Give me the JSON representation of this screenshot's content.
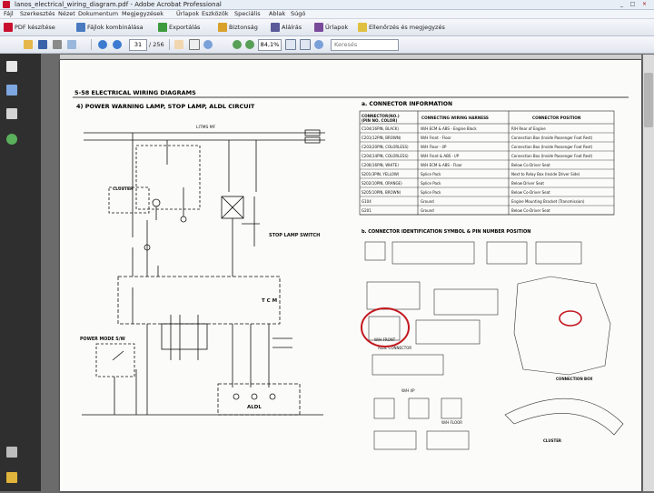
{
  "window": {
    "title": "lanos_electrical_wiring_diagram.pdf - Adobe Acrobat Professional",
    "controls": [
      "_",
      "□",
      "×"
    ]
  },
  "menu": [
    "Fájl",
    "Szerkesztés",
    "Nézet",
    "Dokumentum",
    "Megjegyzések",
    "Űrlapok",
    "Eszközök",
    "Speciális",
    "Ablak",
    "Súgó"
  ],
  "toolbar1": {
    "create_pdf": "PDF készítése",
    "combine": "Fájlok kombinálása",
    "export": "Exportálás",
    "security": "Biztonság",
    "sign": "Aláírás",
    "forms": "Űrlapok",
    "review": "Ellenőrzés és megjegyzés"
  },
  "toolbar2": {
    "page_current": "31",
    "page_total": "/ 256",
    "zoom": "84,1%",
    "search_placeholder": "Keresés"
  },
  "doc": {
    "header": "5-58  ELECTRICAL WIRING DIAGRAMS",
    "left_title": "4)  POWER WARNING LAMP, STOP LAMP, ALDL  CIRCUIT",
    "right_title": "a.  CONNECTOR INFORMATION",
    "conn_symbol_title": "b.  CONNECTOR IDENTIFICATION SYMBOL & PIN NUMBER POSITION",
    "table_headers": [
      "CONNECTOR(NO.)\n(PIN NO. COLOR)",
      "CONNECTING  WIRING HARNESS",
      "CONNECTOR POSITION"
    ],
    "table_rows": [
      [
        "C104(16PIN, BLACK)",
        "W/H ECM & ABS - Engine Block",
        "R/H Rear of Engine"
      ],
      [
        "C201(12PIN, BROWN)",
        "W/H Front - Floor",
        "Connection Box (Inside Passenger Foot Rest)"
      ],
      [
        "C203(20PIN, COLORLESS)",
        "W/H Floor - I/P",
        "Connection Box (Inside Passenger Foot Rest)"
      ],
      [
        "C204(14PIN, COLORLESS)",
        "W/H Front & ABS - I/P",
        "Connection Box (Inside Passenger Foot Rest)"
      ],
      [
        "C206(16PIN, WHITE)",
        "W/H ECM & ABS - Floor",
        "Below Co-Driver Seat"
      ],
      [
        "S201(3PIN, YELLOW)",
        "Splice Pack",
        "Next to Relay Box (Inside Driver Side)"
      ],
      [
        "S202(10PIN, ORANGE)",
        "Splice Pack",
        "Below Driver Seat"
      ],
      [
        "S205(10PIN, BROWN)",
        "Splice Pack",
        "Below Co-Driver Seat"
      ],
      [
        "G104",
        "Ground",
        "Engine Mounting Bracket (Transmission)"
      ],
      [
        "G201",
        "Ground",
        "Below Co-Driver Seat"
      ]
    ],
    "labels": {
      "lamp_circuit": "LITMS MF",
      "cluster": "CLUSTER",
      "stop_lamp_switch": "STOP LAMP SWITCH",
      "tcm": "T C M",
      "power_mode_sw": "POWER MODE S/W",
      "aldl": "ALDL",
      "conn_box": "CONNECTION BOX",
      "cluster2": "CLUSTER",
      "wh_front": "W/H FRONT",
      "aldl_connector": "ALDL CONNECTOR",
      "wh_floor": "W/H FLOOR",
      "wh_ip": "W/H I/P"
    }
  },
  "colors": {
    "highlight_circle": "#c2181f",
    "page_bg": "#fbfbfa"
  }
}
